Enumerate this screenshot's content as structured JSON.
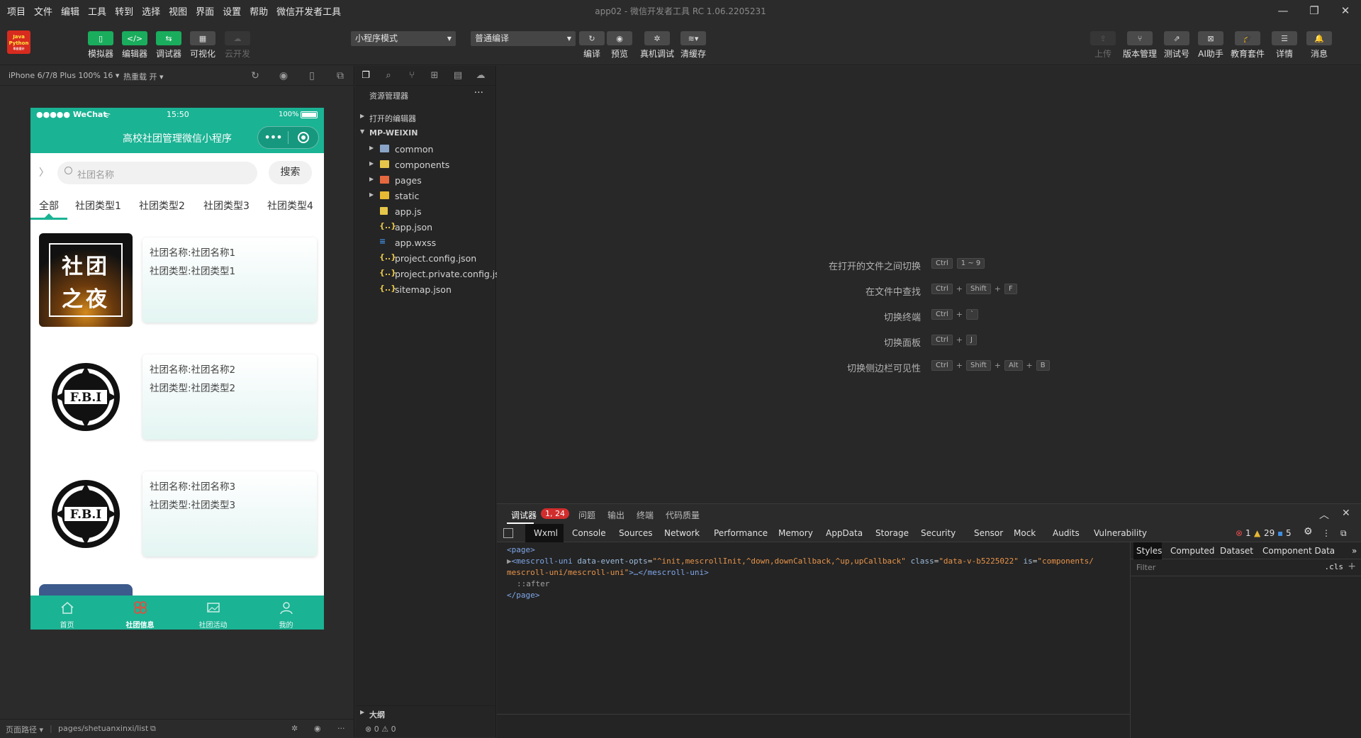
{
  "menu": [
    "项目",
    "文件",
    "编辑",
    "工具",
    "转到",
    "选择",
    "视图",
    "界面",
    "设置",
    "帮助",
    "微信开发者工具"
  ],
  "window_title": "app02 - 微信开发者工具 RC 1.06.2205231",
  "logo": {
    "line1": "Java",
    "line2": "Python",
    "line3": "毕业设计"
  },
  "toolbar": {
    "left": [
      "模拟器",
      "编辑器",
      "调试器",
      "可视化",
      "云开发"
    ],
    "mode_select": "小程序模式",
    "compile_select": "普通编译",
    "mid": [
      "编译",
      "预览",
      "真机调试",
      "清缓存"
    ],
    "right": [
      "上传",
      "版本管理",
      "测试号",
      "AI助手",
      "教育套件",
      "详情",
      "消息"
    ]
  },
  "devicebar": {
    "device": "iPhone 6/7/8 Plus 100% 16",
    "hot_reload": "热重载 开"
  },
  "phone": {
    "carrier": "●●●●● WeChat",
    "time": "15:50",
    "battery": "100%",
    "nav_title": "高校社团管理微信小程序",
    "search_placeholder": "社团名称",
    "search_button": "搜索",
    "tabs": [
      "全部",
      "社团类型1",
      "社团类型2",
      "社团类型3",
      "社团类型4"
    ],
    "cards": [
      {
        "name": "社团名称:社团名称1",
        "type": "社团类型:社团类型1",
        "image_text": [
          "社团",
          "之夜"
        ]
      },
      {
        "name": "社团名称:社团名称2",
        "type": "社团类型:社团类型2",
        "image_text": [
          "F.B.I"
        ]
      },
      {
        "name": "社团名称:社团名称3",
        "type": "社团类型:社团类型3",
        "image_text": [
          "F.B.I"
        ]
      }
    ],
    "tabbar": [
      "首页",
      "社团信息",
      "社团活动",
      "我的"
    ]
  },
  "bottombar": {
    "path_label": "页面路径",
    "path": "pages/shetuanxinxi/list"
  },
  "explorer": {
    "title": "资源管理器",
    "sections": [
      "打开的编辑器",
      "MP-WEIXIN"
    ],
    "files": [
      {
        "name": "common",
        "kind": "folder",
        "color": "#8aa4c8"
      },
      {
        "name": "components",
        "kind": "folder",
        "color": "#e6c64a"
      },
      {
        "name": "pages",
        "kind": "folder",
        "color": "#e5683f"
      },
      {
        "name": "static",
        "kind": "folder",
        "color": "#e6b833"
      },
      {
        "name": "app.js",
        "kind": "js",
        "color": "#e6c64a"
      },
      {
        "name": "app.json",
        "kind": "json",
        "color": "#e6c64a"
      },
      {
        "name": "app.wxss",
        "kind": "css",
        "color": "#3f8fe0"
      },
      {
        "name": "project.config.json",
        "kind": "json",
        "color": "#e6c64a"
      },
      {
        "name": "project.private.config.js...",
        "kind": "json",
        "color": "#e6c64a"
      },
      {
        "name": "sitemap.json",
        "kind": "json",
        "color": "#e6c64a"
      }
    ],
    "outline": "大纲",
    "status": "⊗ 0 ⚠ 0"
  },
  "shortcuts": [
    {
      "label": "在打开的文件之间切换",
      "keys": [
        "Ctrl",
        "1 ~ 9"
      ]
    },
    {
      "label": "在文件中查找",
      "keys": [
        "Ctrl",
        "+",
        "Shift",
        "+",
        "F"
      ]
    },
    {
      "label": "切换终端",
      "keys": [
        "Ctrl",
        "+",
        "`"
      ]
    },
    {
      "label": "切换面板",
      "keys": [
        "Ctrl",
        "+",
        "J"
      ]
    },
    {
      "label": "切换侧边栏可见性",
      "keys": [
        "Ctrl",
        "+",
        "Shift",
        "+",
        "Alt",
        "+",
        "B"
      ]
    }
  ],
  "devtools": {
    "tabs1": [
      "调试器",
      "问题",
      "输出",
      "终端",
      "代码质量"
    ],
    "badge": "1, 24",
    "tabs2": [
      "Wxml",
      "Console",
      "Sources",
      "Network",
      "Performance",
      "Memory",
      "AppData",
      "Storage",
      "Security",
      "Sensor",
      "Mock",
      "Audits",
      "Vulnerability"
    ],
    "counts": {
      "errors": "1",
      "warnings": "29",
      "info": "5"
    },
    "dom": {
      "page_open": "<page>",
      "mescroll_tag": "<mescroll-uni",
      "attr1": "data-event-opts",
      "val1": "\"^init,mescrollInit,^down,downCallback,^up,upCallback\"",
      "attr2": "class",
      "val2": "\"data-v-b5225022\"",
      "attr3": "is",
      "val3": "\"components/",
      "val3b": "mescroll-uni/mescroll-uni\"",
      "close": ">…</mescroll-uni>",
      "after": "::after",
      "page_close": "</page>"
    },
    "styles_tabs": [
      "Styles",
      "Computed",
      "Dataset",
      "Component Data"
    ],
    "filter_placeholder": "Filter",
    "cls": ".cls"
  }
}
